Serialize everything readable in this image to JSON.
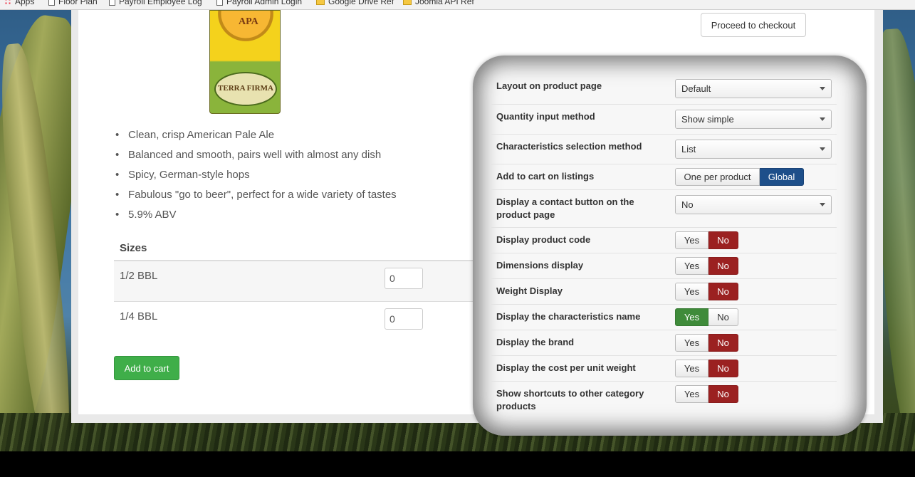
{
  "bookmarks": [
    {
      "label": "Apps",
      "icon": "apps-grid-icon"
    },
    {
      "label": "Floor Plan",
      "icon": "page-icon"
    },
    {
      "label": "Payroll Employee Log",
      "icon": "page-icon"
    },
    {
      "label": "Payroll Admin Login",
      "icon": "page-icon"
    },
    {
      "label": "Google Drive Ref",
      "icon": "folder-icon"
    },
    {
      "label": "Joomla API Ref",
      "icon": "folder-icon"
    }
  ],
  "product": {
    "label_cap_text": "APA",
    "label_brand_text": "TERRA FIRMA",
    "features": [
      "Clean, crisp American Pale Ale",
      "Balanced and smooth, pairs well with almost any dish",
      "Spicy, German-style hops",
      "Fabulous \"go to beer\", perfect for a wide variety of tastes",
      "5.9% ABV"
    ],
    "sizes_header": "Sizes",
    "sizes": [
      {
        "label": "1/2 BBL",
        "qty": "0"
      },
      {
        "label": "1/4 BBL",
        "qty": "0"
      }
    ],
    "add_to_cart": "Add to cart",
    "checkout": "Proceed to checkout"
  },
  "settings": {
    "layout": {
      "label": "Layout on product page",
      "value": "Default"
    },
    "quantity": {
      "label": "Quantity input method",
      "value": "Show simple"
    },
    "characteristics": {
      "label": "Characteristics selection method",
      "value": "List"
    },
    "add_to_cart": {
      "label": "Add to cart on listings",
      "opt1": "One per product",
      "opt2": "Global",
      "selected": "Global"
    },
    "contact": {
      "label": "Display a contact button on the product page",
      "value": "No"
    },
    "toggles": [
      {
        "label": "Display product code",
        "yes": "Yes",
        "no": "No",
        "value": "No"
      },
      {
        "label": "Dimensions display",
        "yes": "Yes",
        "no": "No",
        "value": "No"
      },
      {
        "label": "Weight Display",
        "yes": "Yes",
        "no": "No",
        "value": "No"
      },
      {
        "label": "Display the characteristics name",
        "yes": "Yes",
        "no": "No",
        "value": "Yes"
      },
      {
        "label": "Display the brand",
        "yes": "Yes",
        "no": "No",
        "value": "No"
      },
      {
        "label": "Display the cost per unit weight",
        "yes": "Yes",
        "no": "No",
        "value": "No"
      },
      {
        "label": "Show shortcuts to other category products",
        "yes": "Yes",
        "no": "No",
        "value": "No"
      }
    ]
  },
  "colors": {
    "yes_active": "#3f8b3a",
    "no_active": "#9b2121",
    "global_active": "#1e4f8a",
    "add_button": "#3fae49"
  }
}
